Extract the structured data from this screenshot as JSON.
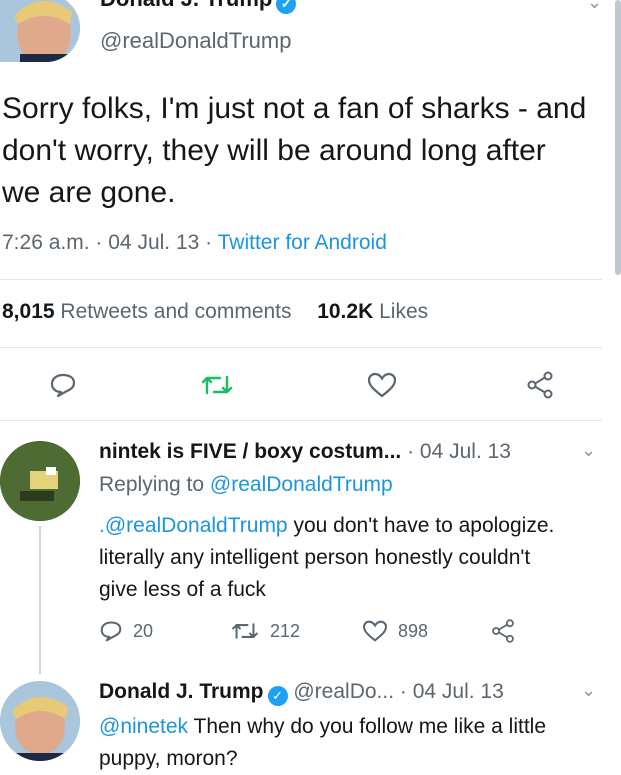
{
  "tweet": {
    "display_name": "Donald J. Trump",
    "handle": "@realDonaldTrump",
    "text": "Sorry folks, I'm just not a fan of sharks - and don't worry, they will be around long after we are gone.",
    "time": "7:26 a.m.",
    "date": "04 Jul. 13",
    "source": "Twitter for Android",
    "separator": "·"
  },
  "stats": {
    "retweets_count": "8,015",
    "retweets_label": "Retweets and comments",
    "likes_count": "10.2K",
    "likes_label": "Likes"
  },
  "replies": [
    {
      "display_name": "nintek is FIVE / boxy costum...",
      "date": "· 04 Jul. 13",
      "replying_prefix": "Replying to",
      "replying_to": "@realDonaldTrump",
      "mention": ".@realDonaldTrump",
      "text": " you don't have to apologize. literally any intelligent person honestly couldn't give less of a fuck",
      "reply_count": "20",
      "retweet_count": "212",
      "like_count": "898"
    },
    {
      "display_name": "Donald J. Trump",
      "handle": "@realDo...",
      "date": "· 04 Jul. 13",
      "mention": "@ninetek",
      "text": " Then why do you follow me like a little puppy, moron?"
    }
  ],
  "icons": {
    "reply": "reply-icon",
    "retweet": "retweet-icon",
    "like": "heart-icon",
    "share": "share-icon",
    "verified": "verified-badge-icon",
    "chevron": "chevron-down-icon"
  },
  "colors": {
    "accent": "#1b95e0",
    "retweet_green": "#17bf63",
    "muted": "#5b6670"
  }
}
